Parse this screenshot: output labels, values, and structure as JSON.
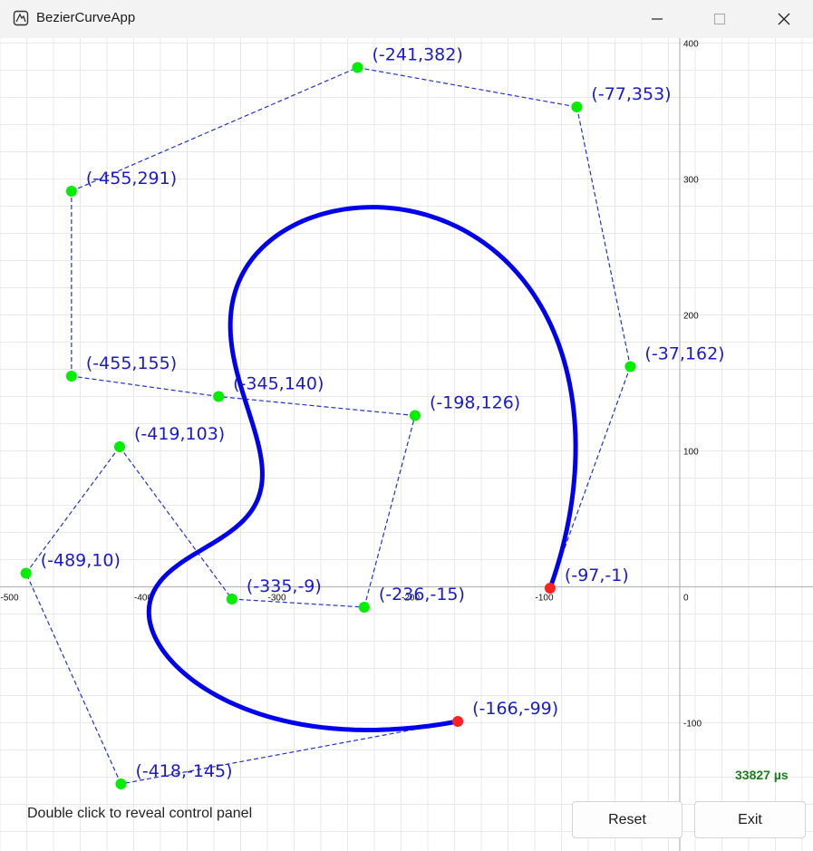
{
  "window": {
    "title": "BezierCurveApp"
  },
  "chart_data": {
    "type": "scatter",
    "xlim": [
      -500,
      100
    ],
    "ylim": [
      -150,
      400
    ],
    "x_ticks": [
      -500,
      -400,
      -300,
      -200,
      -100,
      0
    ],
    "y_ticks": [
      -100,
      100,
      200,
      300,
      400
    ],
    "grid": true,
    "control_points": [
      {
        "x": -166,
        "y": -99,
        "label": "(-166,-99)",
        "endpoint": true
      },
      {
        "x": -418,
        "y": -145,
        "label": "(-418,-145)"
      },
      {
        "x": -489,
        "y": 10,
        "label": "(-489,10)"
      },
      {
        "x": -419,
        "y": 103,
        "label": "(-419,103)"
      },
      {
        "x": -335,
        "y": -9,
        "label": "(-335,-9)"
      },
      {
        "x": -236,
        "y": -15,
        "label": "(-236,-15)"
      },
      {
        "x": -198,
        "y": 126,
        "label": "(-198,126)"
      },
      {
        "x": -345,
        "y": 140,
        "label": "(-345,140)"
      },
      {
        "x": -455,
        "y": 155,
        "label": "(-455,155)"
      },
      {
        "x": -455,
        "y": 291,
        "label": "(-455,291)"
      },
      {
        "x": -241,
        "y": 382,
        "label": "(-241,382)"
      },
      {
        "x": -77,
        "y": 353,
        "label": "(-77,353)"
      },
      {
        "x": -37,
        "y": 162,
        "label": "(-37,162)"
      },
      {
        "x": -97,
        "y": -1,
        "label": "(-97,-1)",
        "endpoint": true
      }
    ],
    "colors": {
      "curve": "#0000ee",
      "polygon": "#2233cc",
      "control": "#00ee00",
      "endpoint": "#ff2020",
      "label": "#1a1acc"
    }
  },
  "status": {
    "timer": "33827 µs",
    "hint": "Double click to reveal control panel"
  },
  "buttons": {
    "reset": "Reset",
    "exit": "Exit"
  }
}
